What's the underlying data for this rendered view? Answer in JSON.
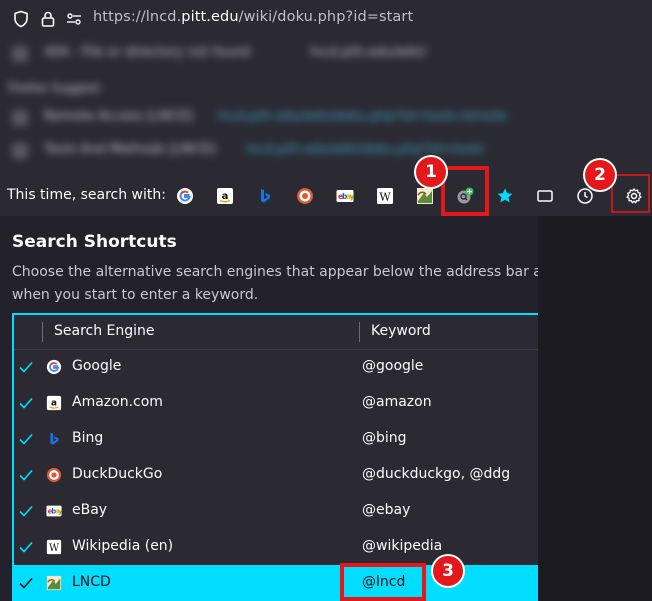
{
  "urlbar": {
    "url_prefix": "https://lncd.",
    "url_domain": "pitt.edu",
    "url_path": "/wiki/doku.php?id=start"
  },
  "dropdown": {
    "blurred_rows": [
      {
        "text": "404 - File or directory not found",
        "link": "lncd.pitt.edu/wiki/"
      },
      {
        "text": "Firefox Suggest",
        "link": ""
      },
      {
        "text": "Remote Access [LNCD]",
        "link": "lncd.pitt.edu/wiki/doku.php?id=tools:remote"
      },
      {
        "text": "Tools And Methods [LNCD]",
        "link": "lncd.pitt.edu/wiki/doku.php?id=tools"
      }
    ],
    "oneoff_label": "This time, search with:",
    "engines": [
      "google-icon",
      "amazon-icon",
      "bing-icon",
      "duckduckgo-icon",
      "ebay-icon",
      "wikipedia-icon",
      "lncd-icon",
      "add-search-engine-icon",
      "bookmarks-star-icon",
      "tabs-icon",
      "history-clock-icon"
    ]
  },
  "callouts": [
    "1",
    "2",
    "3"
  ],
  "settings": {
    "title": "Search Shortcuts",
    "description": "Choose the alternative search engines that appear below the address bar and when you start to enter a keyword.",
    "columns": {
      "engine": "Search Engine",
      "keyword": "Keyword"
    },
    "rows": [
      {
        "name": "Google",
        "keyword": "@google",
        "checked": true,
        "icon": "google-icon"
      },
      {
        "name": "Amazon.com",
        "keyword": "@amazon",
        "checked": true,
        "icon": "amazon-icon"
      },
      {
        "name": "Bing",
        "keyword": "@bing",
        "checked": true,
        "icon": "bing-icon"
      },
      {
        "name": "DuckDuckGo",
        "keyword": "@duckduckgo, @ddg",
        "checked": true,
        "icon": "duckduckgo-icon"
      },
      {
        "name": "eBay",
        "keyword": "@ebay",
        "checked": true,
        "icon": "ebay-icon"
      },
      {
        "name": "Wikipedia (en)",
        "keyword": "@wikipedia",
        "checked": true,
        "icon": "wikipedia-icon"
      },
      {
        "name": "LNCD",
        "keyword": "@lncd",
        "checked": true,
        "icon": "lncd-icon",
        "selected": true
      }
    ]
  },
  "colors": {
    "accent": "#00ddff",
    "annotation": "#e4171b",
    "panel": "#2b2a33",
    "background": "#1c1b22"
  }
}
